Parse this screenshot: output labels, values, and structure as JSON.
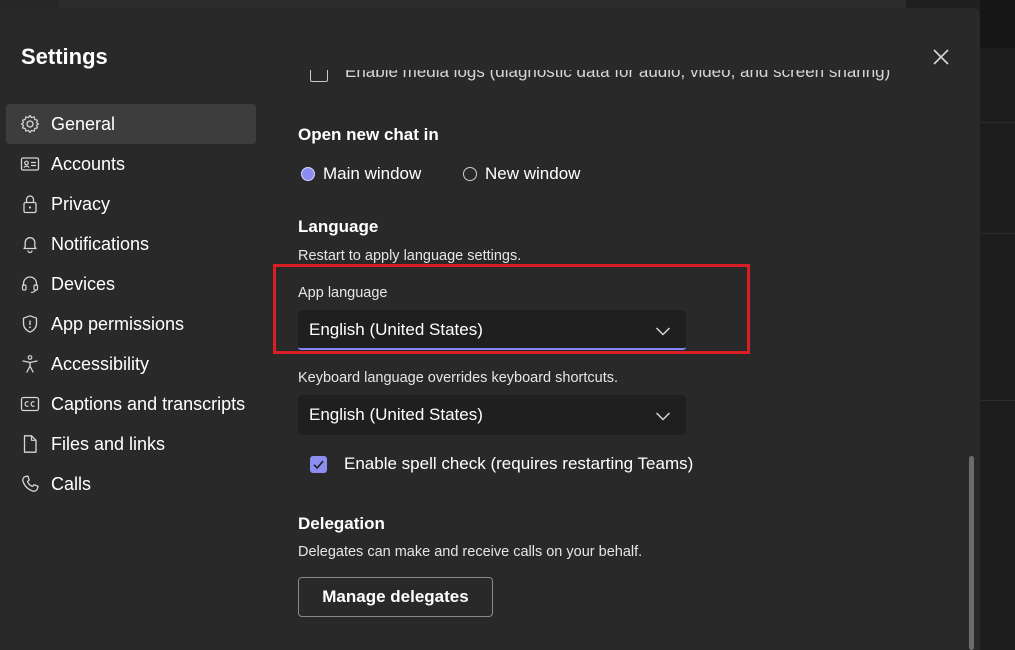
{
  "dialog": {
    "title": "Settings"
  },
  "nav": {
    "items": [
      {
        "label": "General",
        "icon": "gear-icon",
        "active": true
      },
      {
        "label": "Accounts",
        "icon": "id-card-icon"
      },
      {
        "label": "Privacy",
        "icon": "lock-icon"
      },
      {
        "label": "Notifications",
        "icon": "bell-icon"
      },
      {
        "label": "Devices",
        "icon": "headset-icon"
      },
      {
        "label": "App permissions",
        "icon": "shield-icon"
      },
      {
        "label": "Accessibility",
        "icon": "accessibility-icon"
      },
      {
        "label": "Captions and transcripts",
        "icon": "cc-icon"
      },
      {
        "label": "Files and links",
        "icon": "file-icon"
      },
      {
        "label": "Calls",
        "icon": "phone-icon"
      }
    ]
  },
  "content": {
    "cut_off_text": "Enable media logs (diagnostic data for audio, video, and screen sharing)",
    "open_chat": {
      "heading": "Open new chat in",
      "options": [
        {
          "label": "Main window",
          "checked": true
        },
        {
          "label": "New window",
          "checked": false
        }
      ]
    },
    "language": {
      "heading": "Language",
      "description": "Restart to apply language settings.",
      "app_language_label": "App language",
      "app_language_value": "English (United States)",
      "keyboard_label": "Keyboard language overrides keyboard shortcuts.",
      "keyboard_value": "English (United States)",
      "spell_check_label": "Enable spell check (requires restarting Teams)",
      "spell_check_checked": true
    },
    "delegation": {
      "heading": "Delegation",
      "description": "Delegates can make and receive calls on your behalf.",
      "button_label": "Manage delegates"
    }
  },
  "colors": {
    "accent": "#8b8ef0",
    "highlight_box": "#d81f26",
    "dialog_bg": "#292929"
  }
}
